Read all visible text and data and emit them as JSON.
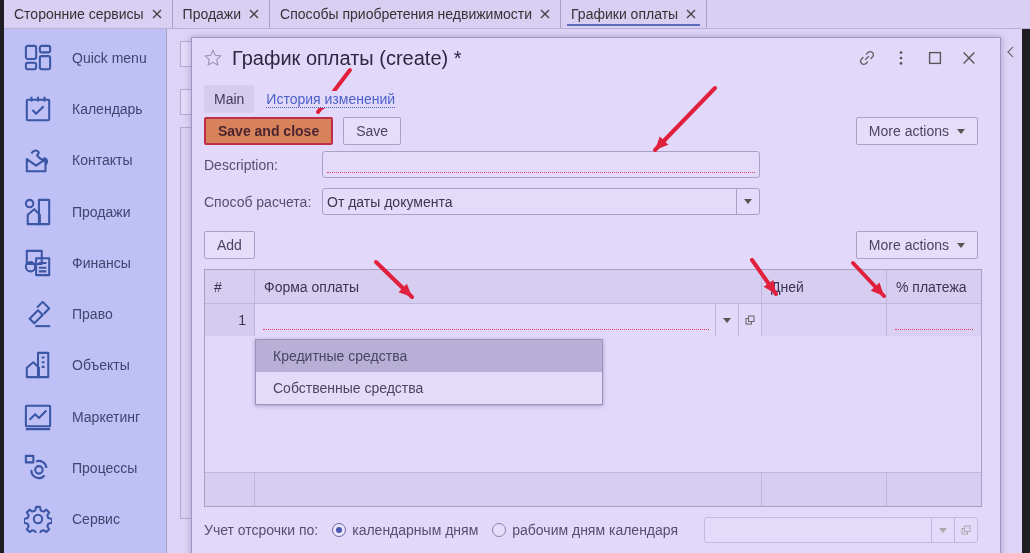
{
  "tabs": [
    {
      "label": "Сторонние сервисы",
      "selected": false
    },
    {
      "label": "Продажи",
      "selected": false
    },
    {
      "label": "Способы приобретения недвижимости",
      "selected": false
    },
    {
      "label": "Графики оплаты",
      "selected": true
    }
  ],
  "sidebar": {
    "items": [
      {
        "label": "Quick menu"
      },
      {
        "label": "Календарь"
      },
      {
        "label": "Контакты"
      },
      {
        "label": "Продажи"
      },
      {
        "label": "Финансы"
      },
      {
        "label": "Право"
      },
      {
        "label": "Объекты"
      },
      {
        "label": "Маркетинг"
      },
      {
        "label": "Процессы"
      },
      {
        "label": "Сервис"
      }
    ]
  },
  "dialog": {
    "title": "График оплаты (create) *",
    "favorite": false,
    "tabs": [
      {
        "label": "Main",
        "selected": true
      },
      {
        "label": "История изменений",
        "selected": false
      }
    ],
    "buttons": [
      {
        "label": "Save and close",
        "kind": "primary"
      },
      {
        "label": "Save",
        "kind": "plain"
      }
    ],
    "more_actions": "More actions",
    "fields": [
      {
        "label": "Description:",
        "kind": "text",
        "required": true
      },
      {
        "label": "Способ расчета:",
        "kind": "select",
        "value": "От даты документа",
        "required": false
      }
    ],
    "table": {
      "add": "Add",
      "more_actions": "More actions",
      "columns": [
        "#",
        "Форма оплаты",
        "Дней",
        "% платежа"
      ],
      "rows": [
        {
          "number": "1",
          "form_required": true,
          "percent_required": true
        }
      ],
      "dropdown": [
        {
          "label": "Кредитные средства",
          "selected": true
        },
        {
          "label": "Собственные средства",
          "selected": false
        }
      ]
    },
    "deferral": {
      "label": "Учет отсрочки по:",
      "options": [
        {
          "label": "календарным дням",
          "selected": true
        },
        {
          "label": "рабочим дням календаря",
          "selected": false
        }
      ]
    }
  }
}
